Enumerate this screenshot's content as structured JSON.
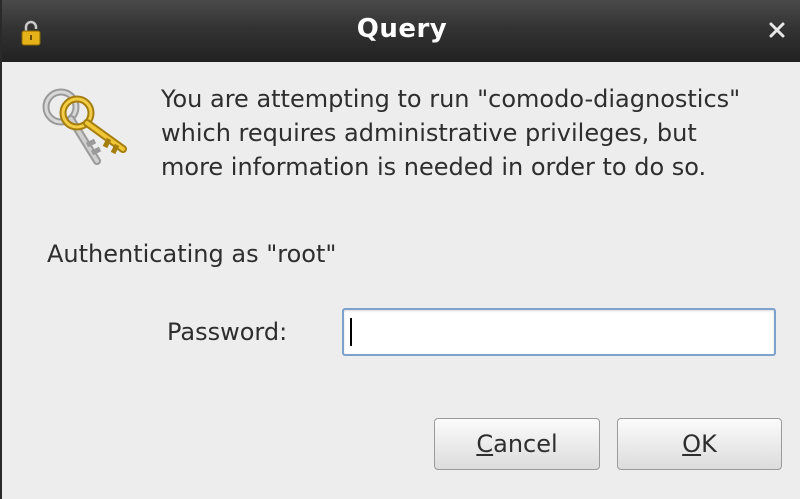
{
  "window": {
    "title": "Query",
    "title_icon": "lock-icon",
    "close_icon": "close-icon"
  },
  "message": {
    "icon": "keys-icon",
    "lines": [
      "You are attempting to run \"comodo-diagnostics\"",
      "which requires administrative privileges, but",
      "more information is needed in order to do so."
    ]
  },
  "auth": {
    "label": "Authenticating as \"root\""
  },
  "password": {
    "label": "Password:",
    "value": "",
    "placeholder": ""
  },
  "buttons": {
    "cancel_first": "C",
    "cancel_rest": "ancel",
    "ok_first": "O",
    "ok_rest": "K"
  },
  "colors": {
    "titlebar": "#333333",
    "dialog_bg": "#ededed",
    "input_border": "#7da2ce",
    "key_gold": "#e8b81f",
    "key_silver": "#b8b8b8"
  }
}
